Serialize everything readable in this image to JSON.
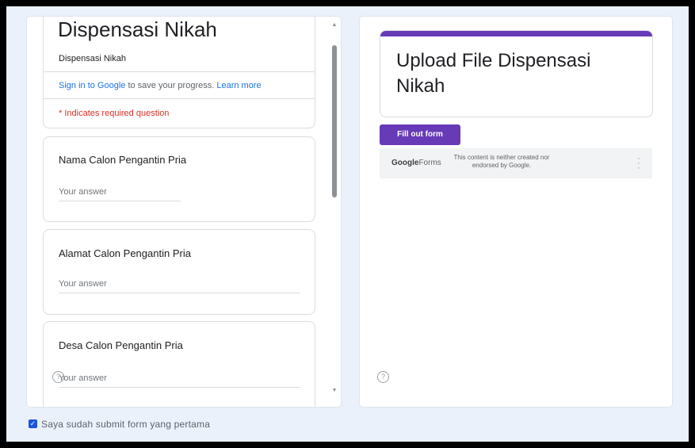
{
  "left_form": {
    "title": "Dispensasi Nikah",
    "description": "Dispensasi Nikah",
    "signin_link": "Sign in to Google",
    "signin_text": " to save your progress. ",
    "learn_more": "Learn more",
    "required_note": "* Indicates required question",
    "questions": [
      {
        "title": "Nama Calon Pengantin Pria",
        "placeholder": "Your answer"
      },
      {
        "title": "Alamat Calon Pengantin Pria",
        "placeholder": "Your answer"
      },
      {
        "title": "Desa Calon Pengantin Pria",
        "placeholder": "Your answer"
      }
    ]
  },
  "right_embed": {
    "title": "Upload File Dispensasi Nikah",
    "fill_button": "Fill out form",
    "footer_logo_bold": "Google",
    "footer_logo": "Forms",
    "footer_note": "This content is neither created nor endorsed by Google."
  },
  "checkbox": {
    "checked": true,
    "label": "Saya sudah submit form yang pertama"
  },
  "icons": {
    "help": "help-circle-icon",
    "scroll_up": "scroll-up-arrow-icon",
    "scroll_down": "scroll-down-arrow-icon",
    "more": "more-vert-icon",
    "check": "check-icon"
  },
  "colors": {
    "accent": "#673ab7",
    "link": "#1a73e8",
    "required": "#d93025",
    "background": "#eaf1fb"
  }
}
